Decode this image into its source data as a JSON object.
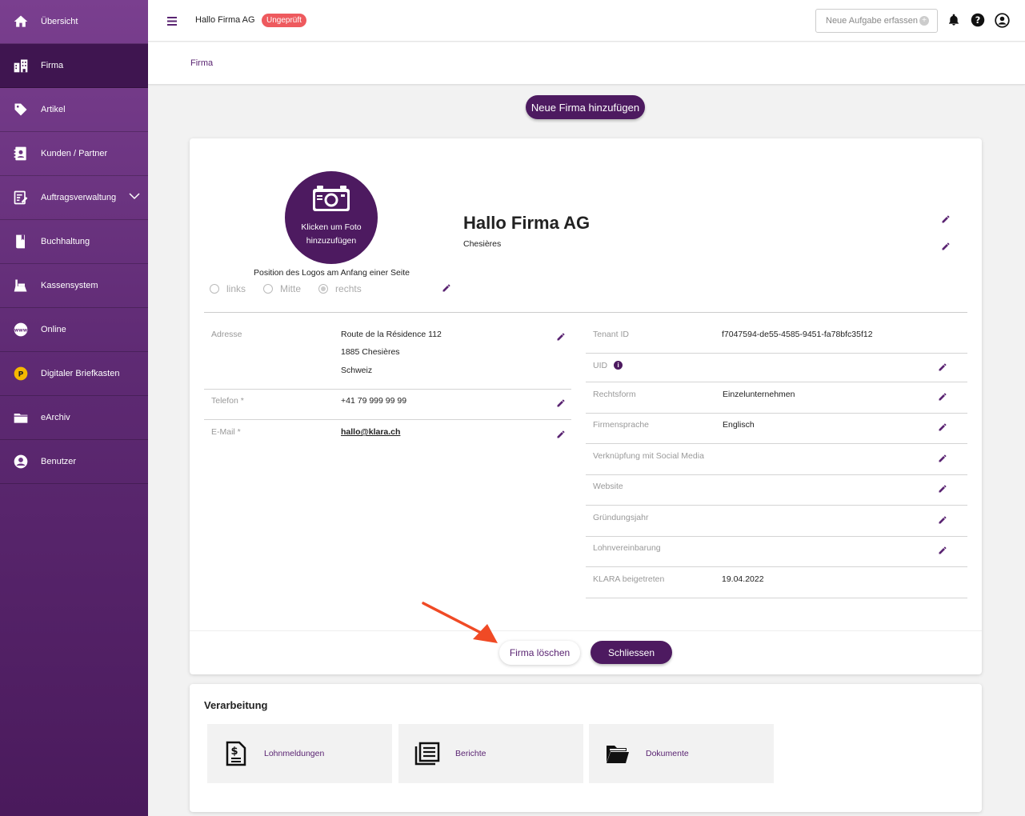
{
  "sidebar": {
    "items": [
      {
        "label": "Übersicht",
        "icon": "home-icon"
      },
      {
        "label": "Firma",
        "icon": "building-icon"
      },
      {
        "label": "Artikel",
        "icon": "tag-icon"
      },
      {
        "label": "Kunden / Partner",
        "icon": "contacts-icon"
      },
      {
        "label": "Auftragsverwaltung",
        "icon": "task-edit-icon"
      },
      {
        "label": "Buchhaltung",
        "icon": "book-icon"
      },
      {
        "label": "Kassensystem",
        "icon": "cash-register-icon"
      },
      {
        "label": "Online",
        "icon": "globe-icon"
      },
      {
        "label": "Digitaler Briefkasten",
        "icon": "mailbox-icon"
      },
      {
        "label": "eArchiv",
        "icon": "folder-icon"
      },
      {
        "label": "Benutzer",
        "icon": "user-icon"
      }
    ],
    "active": "Firma"
  },
  "topbar": {
    "company": "Hallo Firma AG",
    "badge": "Ungeprüft",
    "task_button": "Neue Aufgabe erfassen"
  },
  "breadcrumb": "Firma",
  "add_company_button": "Neue Firma hinzufügen",
  "company": {
    "photo_text": "Klicken um Foto hinzuzufügen",
    "logo_position_label": "Position des Logos am Anfang einer Seite",
    "logo_options": [
      "links",
      "Mitte",
      "rechts"
    ],
    "logo_selected": "rechts",
    "name": "Hallo Firma AG",
    "city": "Chesières",
    "address_label": "Adresse",
    "address_lines": [
      "Route de la Résidence 112",
      "1885 Chesières",
      "Schweiz"
    ],
    "phone_label": "Telefon *",
    "phone": "+41 79 999 99 99",
    "email_label": "E-Mail *",
    "email": "hallo@klara.ch",
    "right_fields": [
      {
        "label": "Tenant ID",
        "value": "f7047594-de55-4585-9451-fa78bfc35f12"
      },
      {
        "label": "UID",
        "value": ""
      },
      {
        "label": "Rechtsform",
        "value": "Einzelunternehmen"
      },
      {
        "label": "Firmensprache",
        "value": "Englisch"
      },
      {
        "label": "Verknüpfung mit Social Media",
        "value": ""
      },
      {
        "label": "Website",
        "value": ""
      },
      {
        "label": "Gründungsjahr",
        "value": ""
      },
      {
        "label": "Lohnvereinbarung",
        "value": ""
      },
      {
        "label": "KLARA beigetreten",
        "value": "19.04.2022"
      }
    ],
    "delete_button": "Firma löschen",
    "close_button": "Schliessen"
  },
  "processing": {
    "title": "Verarbeitung",
    "tiles": [
      {
        "label": "Lohnmeldungen",
        "icon": "payroll-document-icon"
      },
      {
        "label": "Berichte",
        "icon": "reports-icon"
      },
      {
        "label": "Dokumente",
        "icon": "folder-open-icon"
      }
    ]
  },
  "colors": {
    "accent": "#4d1a60",
    "badge": "#ee5a5e",
    "arrow": "#f04a25"
  }
}
